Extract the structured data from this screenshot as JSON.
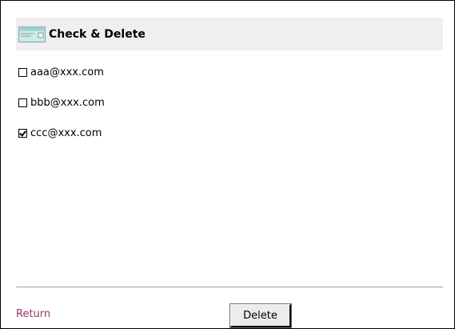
{
  "header": {
    "title": "Check & Delete",
    "icon": "envelope-icon"
  },
  "emails": [
    {
      "address": "aaa@xxx.com",
      "checked": false
    },
    {
      "address": "bbb@xxx.com",
      "checked": false
    },
    {
      "address": "ccc@xxx.com",
      "checked": true
    }
  ],
  "footer": {
    "return_label": "Return",
    "delete_label": "Delete"
  },
  "colors": {
    "header_bg": "#efefef",
    "link": "#993366",
    "divider": "#a0a0a0"
  }
}
